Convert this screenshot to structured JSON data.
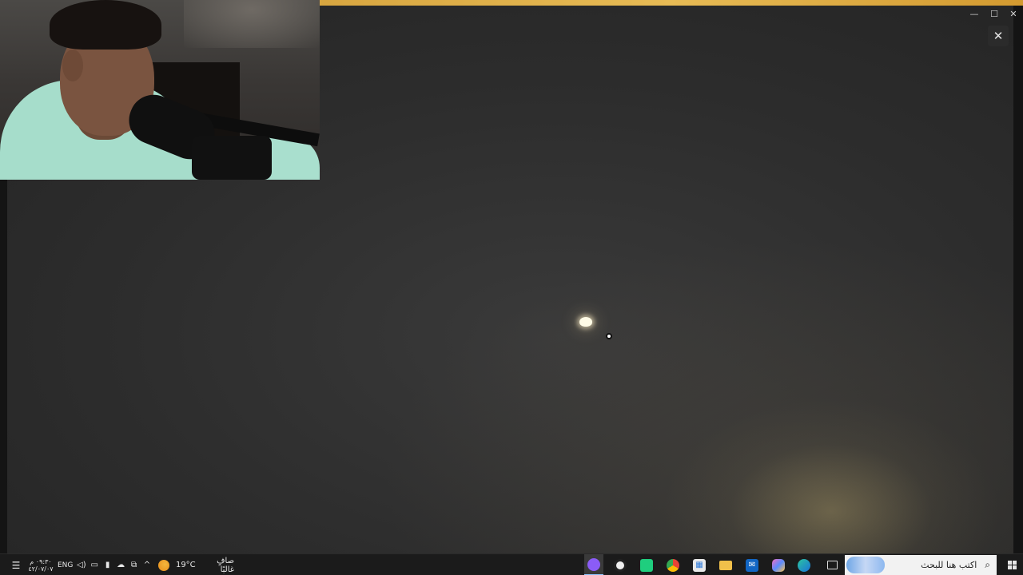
{
  "window": {
    "close_glyph": "✕",
    "min_glyph": "—",
    "max_glyph": "☐",
    "winclose_glyph": "✕"
  },
  "colors": {
    "accent_bar": "#e0b04a",
    "taskbar_bg": "#1b1b1b",
    "photo_bg": "#2f2f2f"
  },
  "taskbar": {
    "search": {
      "placeholder": "اكتب هنا للبحث",
      "icon": "search-icon"
    },
    "apps": [
      {
        "name": "task-view",
        "icon": "task-view-icon"
      },
      {
        "name": "copilot",
        "icon": "copilot-icon"
      },
      {
        "name": "edge",
        "icon": "edge-icon"
      },
      {
        "name": "outlook",
        "icon": "outlook-icon"
      },
      {
        "name": "file-explorer",
        "icon": "folder-icon"
      },
      {
        "name": "microsoft-store",
        "icon": "store-icon"
      },
      {
        "name": "chrome",
        "icon": "chrome-icon"
      },
      {
        "name": "green-app",
        "icon": "green-app-icon"
      },
      {
        "name": "obs",
        "icon": "obs-icon"
      },
      {
        "name": "discord",
        "icon": "discord-icon"
      }
    ],
    "weather": {
      "temp": "19°C",
      "desc": "صافٍ غالبًا"
    },
    "tray": {
      "language": "ENG",
      "chevron": "^"
    },
    "clock": {
      "time": "٠٩:٣٠ م",
      "date": "٤٢/٠٧/٠٧"
    }
  }
}
